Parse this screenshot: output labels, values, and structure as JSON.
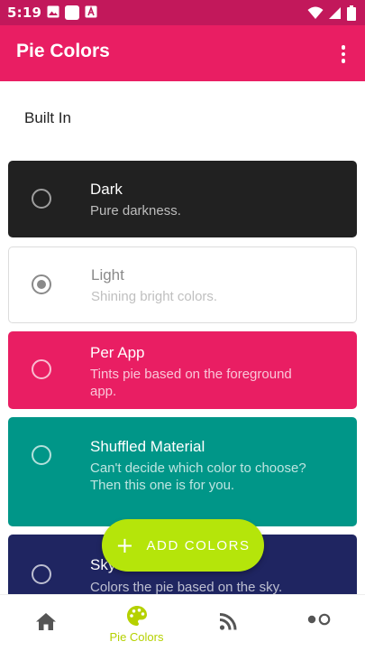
{
  "status_bar": {
    "time": "5:19",
    "left_icons": [
      "image-icon",
      "square-icon",
      "text-icon"
    ],
    "right_icons": [
      "wifi-icon",
      "cellular-icon",
      "battery-icon"
    ]
  },
  "app_bar": {
    "title": "Pie Colors",
    "menu_icon": "overflow-menu-icon"
  },
  "section_header": "Built In",
  "themes": [
    {
      "title": "Dark",
      "subtitle": "Pure darkness.",
      "selected": false,
      "color": "#212121"
    },
    {
      "title": "Light",
      "subtitle": "Shining bright colors.",
      "selected": true,
      "color": "#ffffff"
    },
    {
      "title": "Per App",
      "subtitle": "Tints pie based on the foreground app.",
      "selected": false,
      "color": "#e91e63"
    },
    {
      "title": "Shuffled Material",
      "subtitle": "Can't decide which color to choose? Then this one is for you.",
      "selected": false,
      "color": "#009688"
    },
    {
      "title": "Sky",
      "subtitle": "Colors the pie based on the sky.",
      "selected": false,
      "color": "#1f2561"
    }
  ],
  "fab": {
    "icon": "plus-icon",
    "icon_glyph": "+",
    "label": "ADD COLORS",
    "color": "#b5e50a"
  },
  "bottom_nav": {
    "items": [
      {
        "icon": "home-icon",
        "label": "",
        "active": false
      },
      {
        "icon": "palette-icon",
        "label": "Pie Colors",
        "active": true
      },
      {
        "icon": "rss-feed-icon",
        "label": "",
        "active": false
      },
      {
        "icon": "more-options-icon",
        "label": "",
        "active": false
      }
    ],
    "active_color": "#b5d100"
  },
  "colors": {
    "primary": "#e91e63",
    "primary_dark": "#c2185b",
    "accent": "#b5e50a"
  }
}
